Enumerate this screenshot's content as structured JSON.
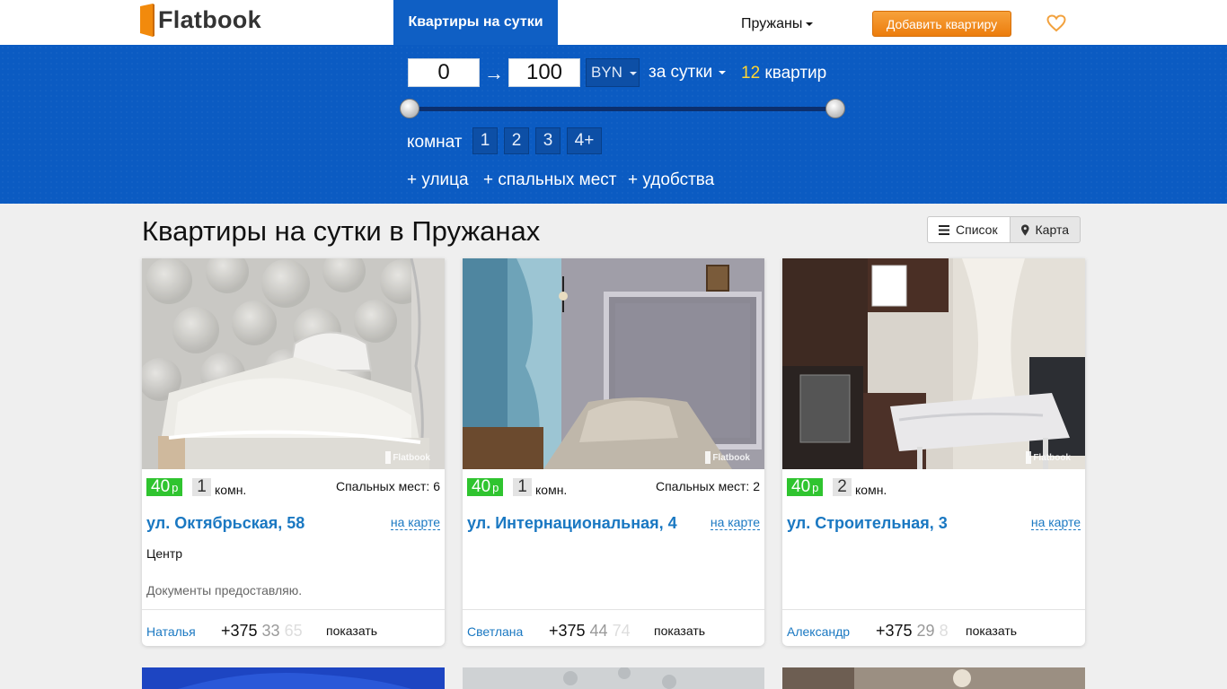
{
  "header": {
    "logo_text": "Flatbook",
    "nav_active": "Квартиры на сутки",
    "city": "Пружаны",
    "add_button": "Добавить квартиру",
    "accent": "#0f5fc4",
    "favorites_icon": "heart-icon"
  },
  "filters": {
    "price_min": "0",
    "price_arrow": "→",
    "price_max": "100",
    "currency": "BYN",
    "period": "за сутки",
    "count_number": "12",
    "count_label": "квартир",
    "price_range_fraction": [
      0,
      1
    ],
    "rooms_label": "комнат",
    "rooms": [
      "1",
      "2",
      "3",
      "4+"
    ],
    "extras": [
      "+ улица",
      "+ спальных мест",
      "+ удобства"
    ]
  },
  "main": {
    "title": "Квартиры на сутки в Пружанах",
    "view_list": "Список",
    "view_map": "Карта"
  },
  "listings": [
    {
      "price": "40",
      "price_unit": "р",
      "rooms": "1",
      "rooms_unit": "комн.",
      "beds": "Спальных мест: 6",
      "street": "ул. Октябрьская, 58",
      "map_link": "на карте",
      "district": "Центр",
      "description": "Документы предоставляю.",
      "owner": "Наталья",
      "phone_visible": "+375 ",
      "phone_fade": "33 ",
      "phone_fade2": "65",
      "show": "показать",
      "watermark": "Flatbook"
    },
    {
      "price": "40",
      "price_unit": "р",
      "rooms": "1",
      "rooms_unit": "комн.",
      "beds": "Спальных мест: 2",
      "street": "ул. Интернациональная, 4",
      "map_link": "на карте",
      "district": "",
      "description": "",
      "owner": "Светлана",
      "phone_visible": "+375 ",
      "phone_fade": "44 ",
      "phone_fade2": "74",
      "show": "показать",
      "watermark": "Flatbook"
    },
    {
      "price": "40",
      "price_unit": "р",
      "rooms": "2",
      "rooms_unit": "комн.",
      "beds": "",
      "street": "ул. Строительная, 3",
      "map_link": "на карте",
      "district": "",
      "description": "",
      "owner": "Александр",
      "phone_visible": "+375 ",
      "phone_fade": "29 ",
      "phone_fade2": "8",
      "show": "показать",
      "watermark": "Flatbook"
    }
  ]
}
